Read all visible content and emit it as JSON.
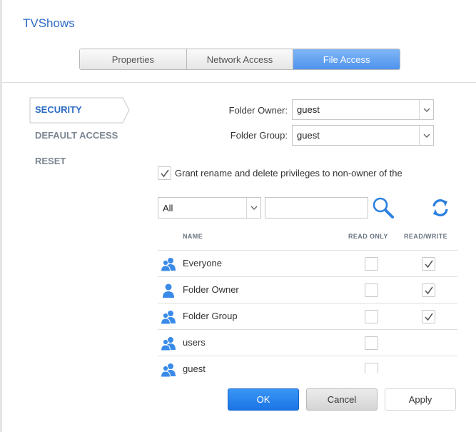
{
  "title": "TVShows",
  "tabs": [
    {
      "label": "Properties",
      "active": false
    },
    {
      "label": "Network Access",
      "active": false
    },
    {
      "label": "File Access",
      "active": true
    }
  ],
  "nav": {
    "security": "SECURITY",
    "default_access": "DEFAULT ACCESS",
    "reset": "RESET"
  },
  "owner": {
    "label": "Folder Owner:",
    "value": "guest"
  },
  "group": {
    "label": "Folder Group:",
    "value": "guest"
  },
  "grant": {
    "label": "Grant rename and delete privileges to non-owner of the",
    "checked": true
  },
  "filter": {
    "value": "All"
  },
  "search": {
    "placeholder": "",
    "value": ""
  },
  "table": {
    "headers": {
      "name": "NAME",
      "read_only": "READ ONLY",
      "read_write": "READ/WRITE"
    },
    "rows": [
      {
        "name": "Everyone",
        "icon": "group-icon",
        "read_only": false,
        "read_write": true,
        "rw_shown": true
      },
      {
        "name": "Folder Owner",
        "icon": "user-icon",
        "read_only": false,
        "read_write": true,
        "rw_shown": true
      },
      {
        "name": "Folder Group",
        "icon": "group-icon",
        "read_only": false,
        "read_write": true,
        "rw_shown": true
      },
      {
        "name": "users",
        "icon": "group-icon",
        "read_only": false,
        "read_write": false,
        "rw_shown": false
      },
      {
        "name": "guest",
        "icon": "group-icon",
        "read_only": false,
        "read_write": false,
        "rw_shown": false
      }
    ]
  },
  "buttons": {
    "ok": "OK",
    "cancel": "Cancel",
    "apply": "Apply"
  },
  "colors": {
    "accent": "#2d6bc4",
    "active_tab": "#5c9ef2",
    "ok_button": "#2483ee",
    "icon_blue": "#3a8be8"
  }
}
